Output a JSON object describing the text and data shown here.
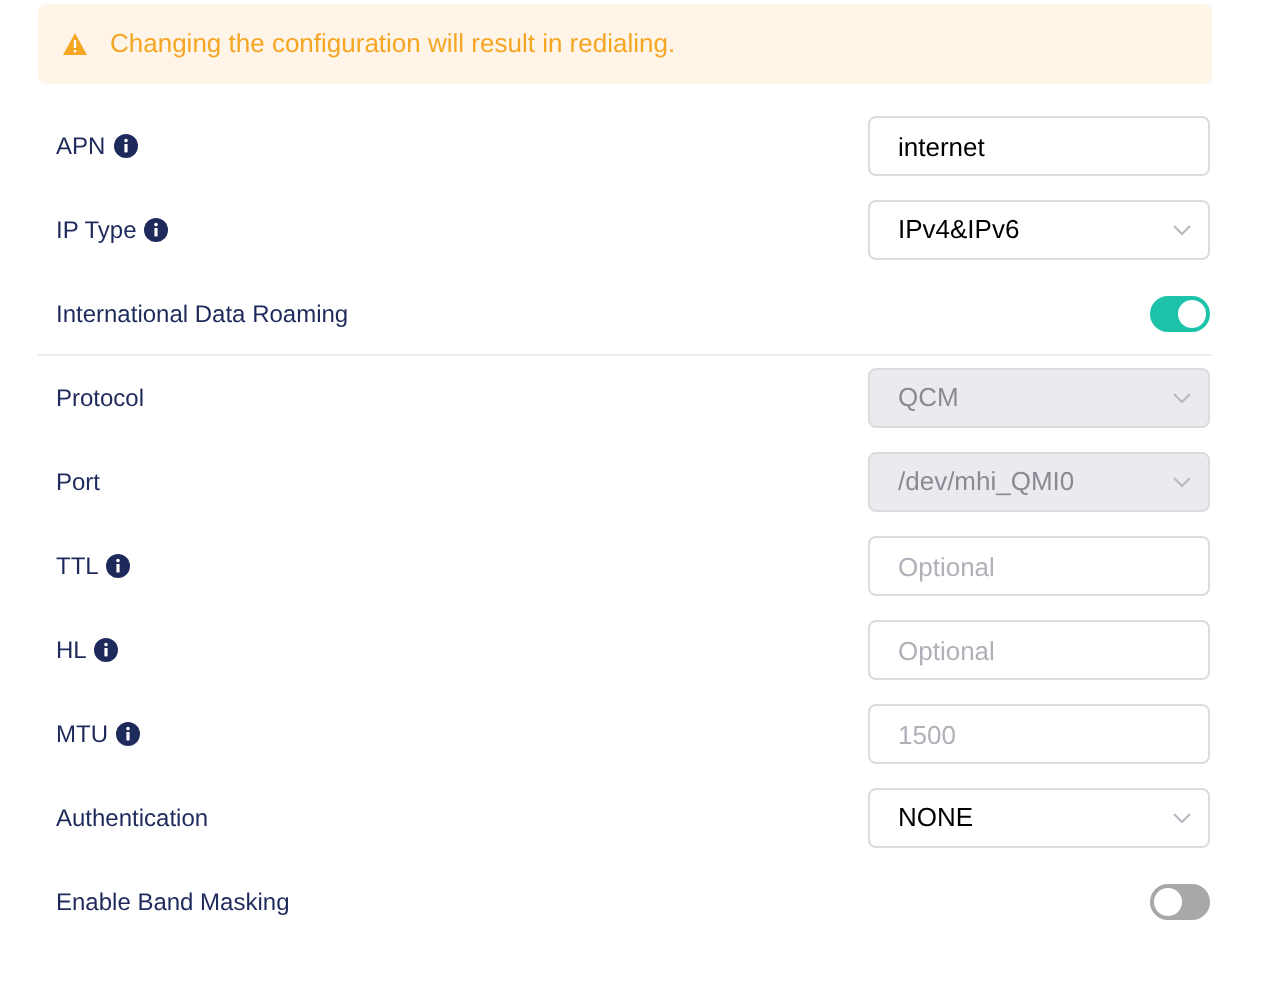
{
  "alert": {
    "text": "Changing the configuration will result in redialing."
  },
  "rows": [
    {
      "kind": "input",
      "label": "APN",
      "info": true,
      "value": "internet",
      "disabled": false,
      "divider": false
    },
    {
      "kind": "select",
      "label": "IP Type",
      "info": true,
      "value": "IPv4&IPv6",
      "disabled": false,
      "divider": false
    },
    {
      "kind": "toggle",
      "label": "International Data Roaming",
      "info": false,
      "on": true,
      "divider": true
    },
    {
      "kind": "select",
      "label": "Protocol",
      "info": false,
      "value": "QCM",
      "disabled": true,
      "divider": false
    },
    {
      "kind": "select",
      "label": "Port",
      "info": false,
      "value": "/dev/mhi_QMI0",
      "disabled": true,
      "divider": false
    },
    {
      "kind": "input",
      "label": "TTL",
      "info": true,
      "placeholder": "Optional",
      "disabled": false,
      "divider": false
    },
    {
      "kind": "input",
      "label": "HL",
      "info": true,
      "placeholder": "Optional",
      "disabled": false,
      "divider": false
    },
    {
      "kind": "input",
      "label": "MTU",
      "info": true,
      "placeholder": "1500",
      "disabled": false,
      "divider": false
    },
    {
      "kind": "select",
      "label": "Authentication",
      "info": false,
      "value": "NONE",
      "disabled": false,
      "divider": false
    },
    {
      "kind": "toggle",
      "label": "Enable Band Masking",
      "info": false,
      "on": false,
      "divider": false
    }
  ]
}
